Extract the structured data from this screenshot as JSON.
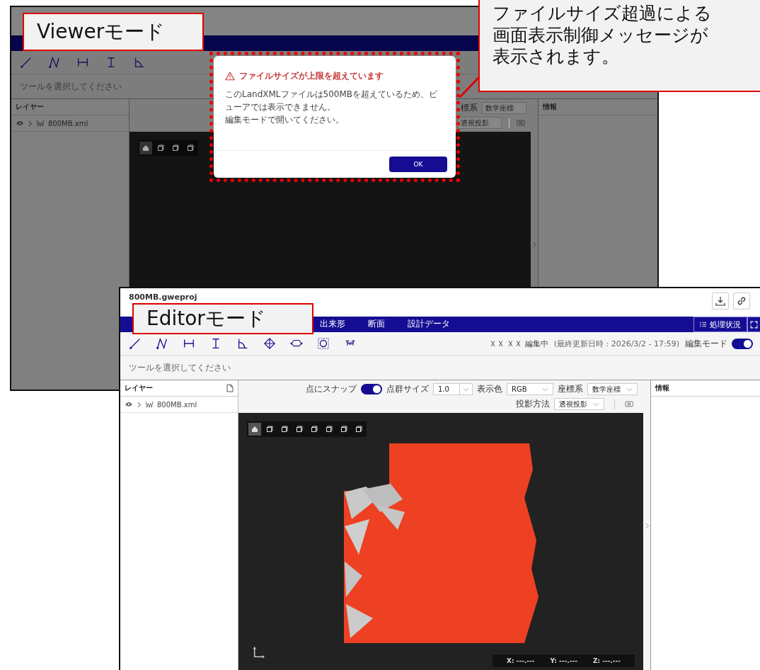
{
  "viewer_window": {
    "tool_hint": "ツールを選択してください",
    "layer_panel": {
      "title": "レイヤー",
      "items": [
        {
          "name": "800MB.xml"
        }
      ]
    },
    "view_control_rows": [
      [
        {
          "kind": "select",
          "label": "標系",
          "value": "数学座標"
        }
      ],
      [
        {
          "kind": "select",
          "value": "透視投影"
        }
      ]
    ],
    "view_buttons": [
      {
        "selected": true
      },
      {
        "selected": false
      },
      {
        "selected": false
      },
      {
        "selected": false
      }
    ],
    "info_panel": {
      "title": "情報"
    }
  },
  "dialog": {
    "title": "ファイルサイズが上限を超えています",
    "message_lines": [
      "このLandXMLファイルは500MBを超えているため、ビ",
      "ューアでは表示できません。",
      "編集モードで開いてください。"
    ],
    "button": "OK"
  },
  "editor_window": {
    "title": "800MB.gweproj",
    "tabs": [
      {
        "label": "出来形",
        "selected": false
      },
      {
        "label": "断面",
        "selected": false
      },
      {
        "label": "設計データ",
        "selected": false
      }
    ],
    "status_button": "処理状況",
    "editor_status": "ＸＸ ＸＸ 編集中",
    "last_updated": "(最終更新日時 : 2026/3/2 - 17:59)",
    "edit_mode": {
      "label": "編集モード",
      "on": true
    },
    "tool_hint": "ツールを選択してください",
    "layer_panel": {
      "title": "レイヤー",
      "items": [
        {
          "name": "800MB.xml"
        }
      ]
    },
    "view_control_rows": [
      [
        {
          "kind": "toggle",
          "label": "点にスナップ",
          "on": true
        },
        {
          "kind": "number",
          "label": "点群サイズ",
          "value": "1.0"
        },
        {
          "kind": "select",
          "label": "表示色",
          "value": "RGB"
        },
        {
          "kind": "select",
          "label": "座標系",
          "value": "数学座標"
        }
      ],
      [
        {
          "kind": "select",
          "label": "投影方法",
          "value": "透視投影"
        }
      ]
    ],
    "view_buttons": [
      {
        "selected": true
      },
      {
        "selected": false
      },
      {
        "selected": false
      },
      {
        "selected": false
      },
      {
        "selected": false
      },
      {
        "selected": false
      },
      {
        "selected": false
      },
      {
        "selected": false
      }
    ],
    "coordinates": [
      "X: ---.---",
      "Y: ---.---",
      "Z: ---.---"
    ],
    "info_panel": {
      "title": "情報"
    }
  },
  "callouts": [
    {
      "lines": [
        "Viewerモード"
      ]
    },
    {
      "lines": [
        "Editorモード"
      ]
    },
    {
      "lines": [
        "ファイルサイズ超過による",
        "画面表示制御メッセージが",
        "表示されます。"
      ]
    }
  ]
}
